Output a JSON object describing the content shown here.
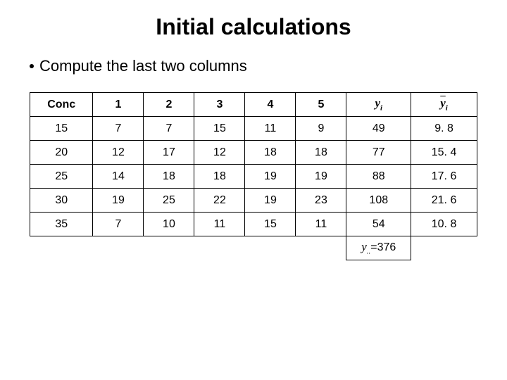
{
  "title": "Initial calculations",
  "subtitle": "Compute the last two columns",
  "headers": {
    "conc": "Conc",
    "h1": "1",
    "h2": "2",
    "h3": "3",
    "h4": "4",
    "h5": "5",
    "sum_label_var": "y",
    "sum_label_sub": "i",
    "mean_label_var": "y",
    "mean_label_sub": "i"
  },
  "rows": [
    {
      "conc": "15",
      "c1": "7",
      "c2": "7",
      "c3": "15",
      "c4": "11",
      "c5": "9",
      "sum": "49",
      "mean": "9. 8"
    },
    {
      "conc": "20",
      "c1": "12",
      "c2": "17",
      "c3": "12",
      "c4": "18",
      "c5": "18",
      "sum": "77",
      "mean": "15. 4"
    },
    {
      "conc": "25",
      "c1": "14",
      "c2": "18",
      "c3": "18",
      "c4": "19",
      "c5": "19",
      "sum": "88",
      "mean": "17. 6"
    },
    {
      "conc": "30",
      "c1": "19",
      "c2": "25",
      "c3": "22",
      "c4": "19",
      "c5": "23",
      "sum": "108",
      "mean": "21. 6"
    },
    {
      "conc": "35",
      "c1": "7",
      "c2": "10",
      "c3": "11",
      "c4": "15",
      "c5": "11",
      "sum": "54",
      "mean": "10. 8"
    }
  ],
  "total": {
    "prefix_var": "y",
    "prefix_sub": "..",
    "value": "=376"
  },
  "chart_data": {
    "type": "table",
    "title": "Initial calculations",
    "columns": [
      "Conc",
      "1",
      "2",
      "3",
      "4",
      "5",
      "y_i.",
      "ybar_i"
    ],
    "rows": [
      [
        15,
        7,
        7,
        15,
        11,
        9,
        49,
        9.8
      ],
      [
        20,
        12,
        17,
        12,
        18,
        18,
        77,
        15.4
      ],
      [
        25,
        14,
        18,
        18,
        19,
        19,
        88,
        17.6
      ],
      [
        30,
        19,
        25,
        22,
        19,
        23,
        108,
        21.6
      ],
      [
        35,
        7,
        10,
        11,
        15,
        11,
        54,
        10.8
      ]
    ],
    "grand_total": 376
  }
}
